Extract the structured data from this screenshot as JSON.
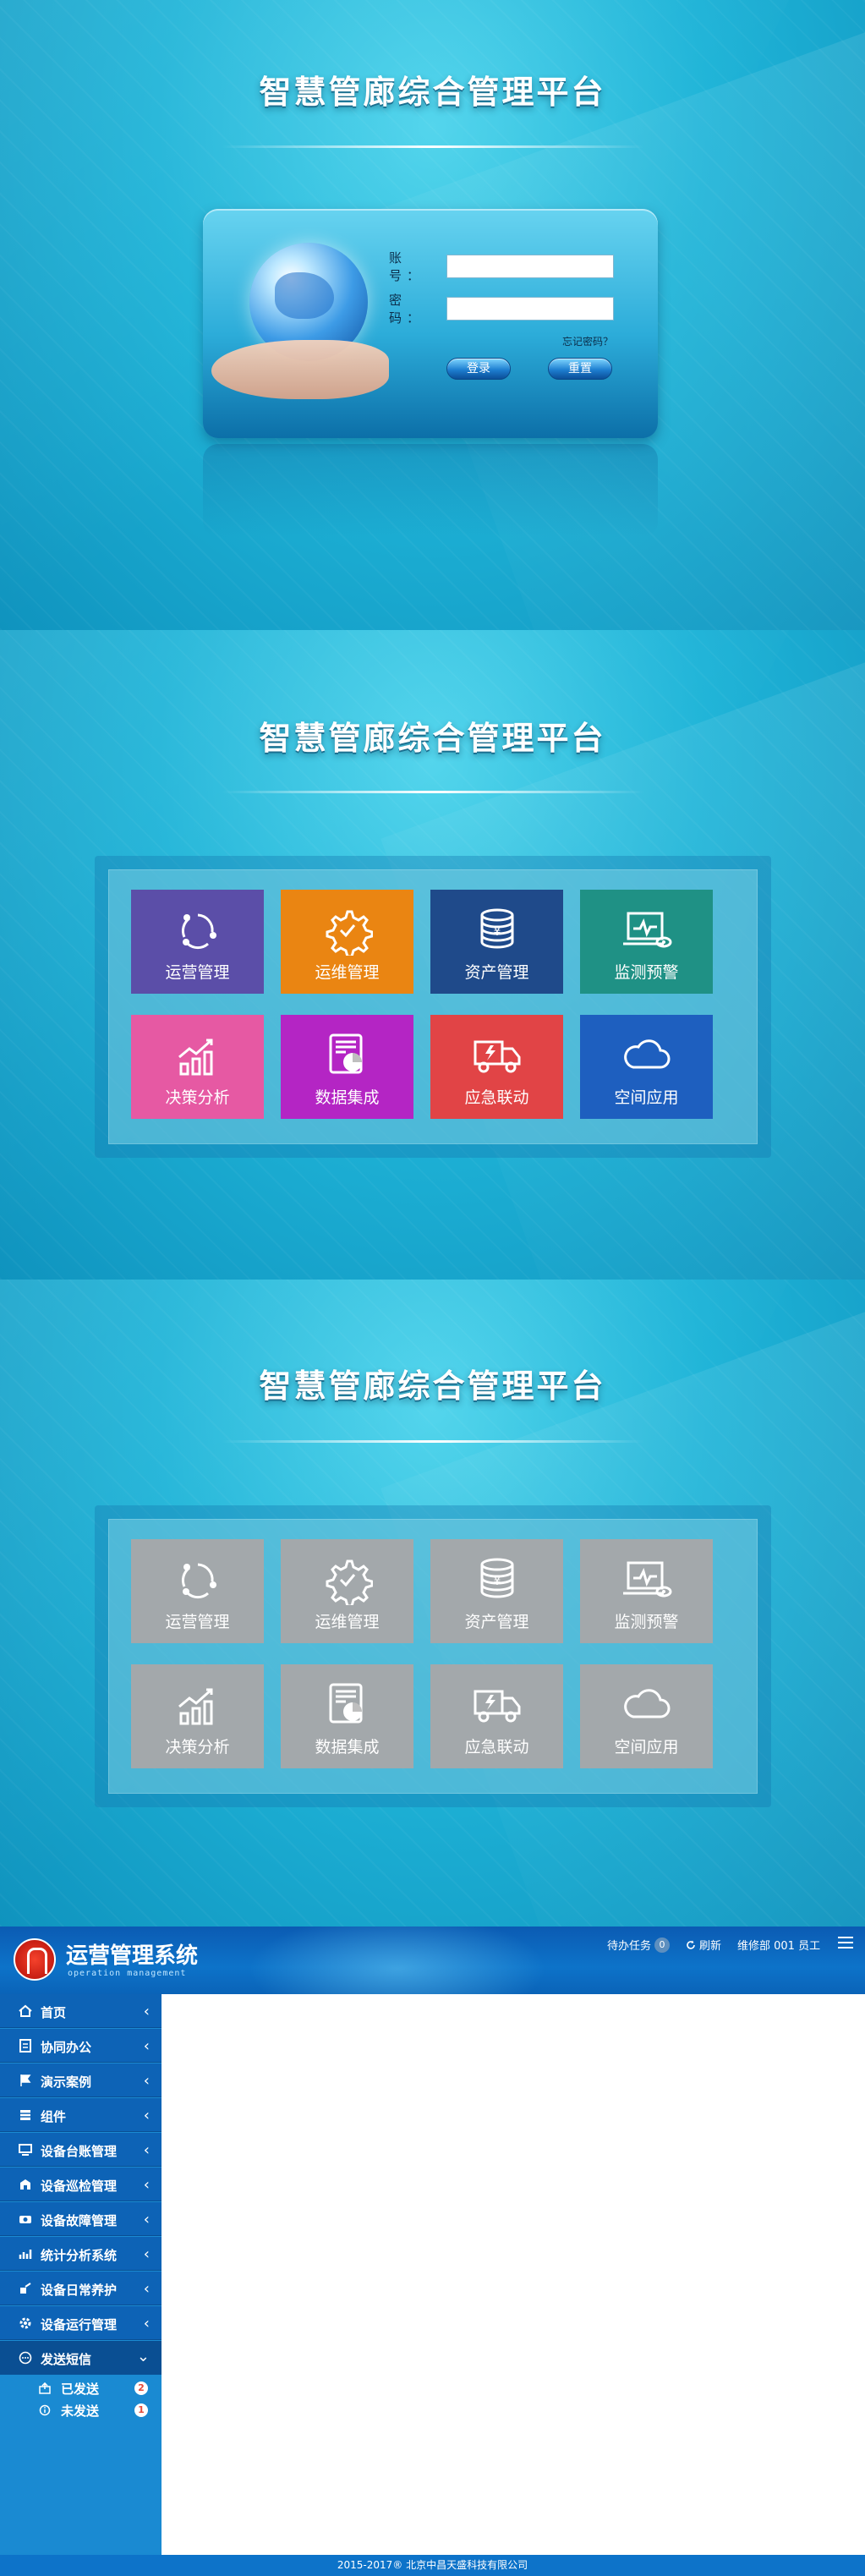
{
  "login_screen": {
    "platform_title": "智慧管廊综合管理平台",
    "account_label": "账 号：",
    "password_label": "密 码：",
    "account_value": "",
    "password_value": "",
    "forgot_password": "忘记密码？",
    "login_button": "登录",
    "reset_button": "重置"
  },
  "module_screen_active": {
    "platform_title": "智慧管廊综合管理平台",
    "tiles": [
      {
        "label": "运营管理",
        "icon": "cycle-icon",
        "color": "#5b4ea8"
      },
      {
        "label": "运维管理",
        "icon": "gear-icon",
        "color": "#ea8512"
      },
      {
        "label": "资产管理",
        "icon": "coins-icon",
        "color": "#1f4a8a"
      },
      {
        "label": "监测预警",
        "icon": "monitor-icon",
        "color": "#1f9185"
      },
      {
        "label": "决策分析",
        "icon": "bar-chart-icon",
        "color": "#e659a3"
      },
      {
        "label": "数据集成",
        "icon": "document-chart-icon",
        "color": "#b425c4"
      },
      {
        "label": "应急联动",
        "icon": "truck-icon",
        "color": "#e14446"
      },
      {
        "label": "空间应用",
        "icon": "cloud-icon",
        "color": "#1e5fbf"
      }
    ]
  },
  "module_screen_inactive": {
    "platform_title": "智慧管廊综合管理平台",
    "tile_color": "#a3a8ab",
    "tiles": [
      {
        "label": "运营管理",
        "icon": "cycle-icon"
      },
      {
        "label": "运维管理",
        "icon": "gear-icon"
      },
      {
        "label": "资产管理",
        "icon": "coins-icon"
      },
      {
        "label": "监测预警",
        "icon": "monitor-icon"
      },
      {
        "label": "决策分析",
        "icon": "bar-chart-icon"
      },
      {
        "label": "数据集成",
        "icon": "document-chart-icon"
      },
      {
        "label": "应急联动",
        "icon": "truck-icon"
      },
      {
        "label": "空间应用",
        "icon": "cloud-icon"
      }
    ]
  },
  "ops_system": {
    "title": "运营管理系统",
    "subtitle": "operation management",
    "pending_label": "待办任务",
    "pending_count": "0",
    "refresh_label": "刷新",
    "user_label": "维修部 001 员工",
    "sidebar": [
      {
        "label": "首页",
        "icon": "home-icon"
      },
      {
        "label": "协同办公",
        "icon": "document-icon"
      },
      {
        "label": "演示案例",
        "icon": "flag-icon"
      },
      {
        "label": "组件",
        "icon": "layers-icon"
      },
      {
        "label": "设备台账管理",
        "icon": "monitor-icon"
      },
      {
        "label": "设备巡检管理",
        "icon": "inspection-icon"
      },
      {
        "label": "设备故障管理",
        "icon": "fault-icon"
      },
      {
        "label": "统计分析系统",
        "icon": "stats-icon"
      },
      {
        "label": "设备日常养护",
        "icon": "maintenance-icon"
      },
      {
        "label": "设备运行管理",
        "icon": "gear-icon"
      },
      {
        "label": "发送短信",
        "icon": "message-icon"
      }
    ],
    "sms_sub": [
      {
        "label": "已发送",
        "count": "2",
        "icon": "sent-icon"
      },
      {
        "label": "未发送",
        "count": "1",
        "icon": "info-icon"
      }
    ],
    "footer": "2015-2017® 北京中昌天盛科技有限公司",
    "colors": {
      "header": "#0d73c9",
      "sidebar_item": "#0d63b6",
      "sidebar_bg": "#1a8ad2"
    }
  }
}
